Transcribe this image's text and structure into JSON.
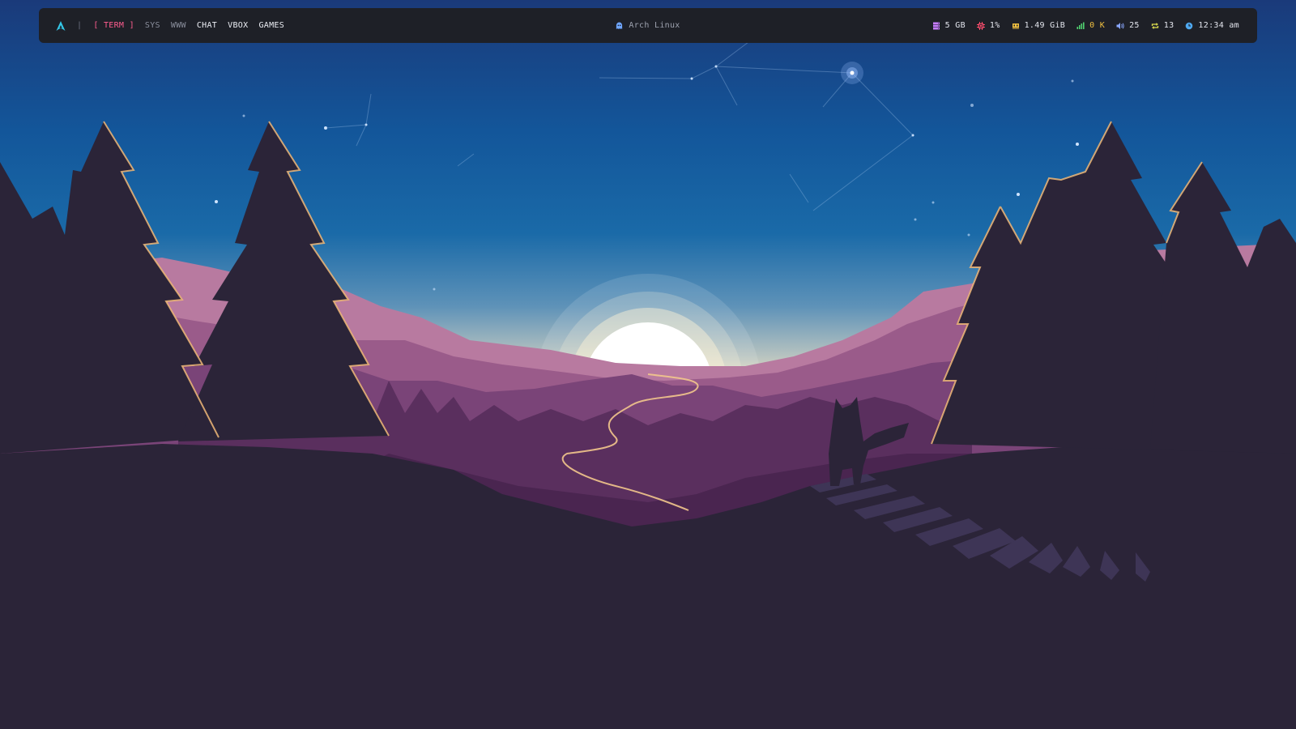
{
  "bar": {
    "workspaces": [
      {
        "label": "[ TERM ]",
        "state": "active"
      },
      {
        "label": "SYS",
        "state": "inactive"
      },
      {
        "label": "WWW",
        "state": "inactive"
      },
      {
        "label": "CHAT",
        "state": "occupied"
      },
      {
        "label": "VBOX",
        "state": "occupied"
      },
      {
        "label": "GAMES",
        "state": "occupied"
      }
    ],
    "separator": "|",
    "title": "Arch Linux",
    "modules": {
      "disk": {
        "value": "5 GB",
        "icon": "disk-icon",
        "color": "#c77dff"
      },
      "cpu": {
        "value": "1%",
        "icon": "cpu-icon",
        "color": "#ff4d6d"
      },
      "memory": {
        "value": "1.49 GiB",
        "icon": "memory-icon",
        "color": "#f0c040"
      },
      "network": {
        "value": "0 K",
        "icon": "network-icon",
        "color": "#50d070"
      },
      "volume": {
        "value": "25",
        "icon": "volume-icon",
        "color": "#8aa8ff"
      },
      "updates": {
        "value": "13",
        "icon": "updates-icon",
        "color": "#e0e050"
      },
      "clock": {
        "value": "12:34 am",
        "icon": "clock-icon",
        "color": "#4ea8f0"
      }
    }
  },
  "colors": {
    "bar_bg": "#1e2027",
    "active_workspace": "#ff5d8f",
    "arch_logo": "#34c8e8"
  }
}
